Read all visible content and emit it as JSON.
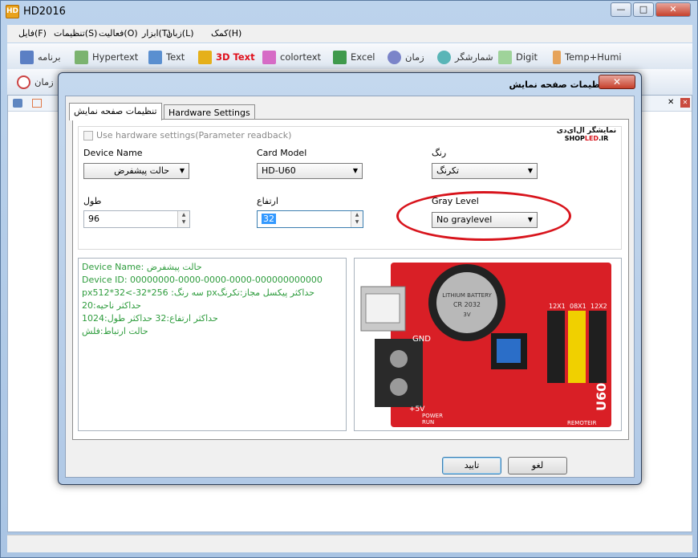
{
  "app": {
    "title": "HD2016",
    "logo": "HD"
  },
  "window_controls": {
    "minimize": "—",
    "maximize": "□",
    "close": "✕"
  },
  "menubar": [
    {
      "label": "(H)کمک"
    },
    {
      "label": "(L)زبان"
    },
    {
      "label": "(T)ابزار"
    },
    {
      "label": "(O)فعالیت"
    },
    {
      "label": "(S)تنظیمات"
    },
    {
      "label": "(F)فایل"
    }
  ],
  "toolbar": [
    {
      "label": "برنامه",
      "icon": "program-icon",
      "color": "#5b7fc4"
    },
    {
      "label": "Hypertext",
      "icon": "hypertext-icon",
      "color": "#7bb36f"
    },
    {
      "label": "Text",
      "icon": "text-icon",
      "color": "#5a8fd0"
    },
    {
      "label": "3D Text",
      "icon": "3d-text-icon",
      "color": "#e5b01a",
      "text_color": "#e0101c"
    },
    {
      "label": "colortext",
      "icon": "colortext-icon",
      "color": "#d66bc6"
    },
    {
      "label": "Excel",
      "icon": "excel-icon",
      "color": "#3f9a4c"
    },
    {
      "label": "زمان",
      "icon": "clock-icon",
      "color": "#7b84c9"
    },
    {
      "label": "شمارشگر",
      "icon": "counter-icon",
      "color": "#59b5b7"
    },
    {
      "label": "Digit",
      "icon": "digit-icon",
      "color": "#9fd39a"
    },
    {
      "label": "Temp+Humi",
      "icon": "thermometer-icon",
      "color": "#e6a35a"
    }
  ],
  "toolbar2": {
    "label": "زمان",
    "icon": "stopwatch-icon"
  },
  "dialog": {
    "title": "تنظیمات صفحه نمایش",
    "close": "✕",
    "tabs": [
      {
        "label": "تنظیمات صفحه نمایش"
      },
      {
        "label": "Hardware Settings"
      }
    ],
    "use_hw_checkbox": "Use hardware settings(Parameter readback)",
    "brand": {
      "line1": "نمایشگر ال‌ای‌دی",
      "line2_a": "SHOP",
      "line2_b": "LED",
      "line2_c": ".IR"
    },
    "fields": {
      "device_name": {
        "label": "Device Name",
        "value": "حالت پیشفرض"
      },
      "card_model": {
        "label": "Card Model",
        "value": "HD-U60"
      },
      "color": {
        "label": "رنگ",
        "value": "تکرنگ"
      },
      "width": {
        "label": "طول",
        "value": "96"
      },
      "height": {
        "label": "ارتفاع",
        "value": "32"
      },
      "gray_level": {
        "label": "Gray Level",
        "value": "No graylevel"
      }
    },
    "info_lines": [
      "Device Name: حالت پیشفرض",
      "Device ID:  00000000-0000-0000-0000-000000000000",
      "px512*32<-سه رنگ: 256*32 pxحداکثر پیکسل مجاز:تکرنگ",
      "حداکثر ناحیه:20",
      "حداکثر ارتفاع:32 حداکثر طول:1024",
      "حالت ارتباط:فلش"
    ],
    "board": {
      "battery_text": "LITHIUM BATTERY",
      "battery_code": "CR 2032",
      "battery_volt": "3V",
      "label_gnd": "GND",
      "label_5v": "+5V",
      "label_model": "U60",
      "label_hub1": "12X1",
      "label_hub2": "08X1",
      "label_hub3": "12X2",
      "label_remote": "REMOTEIR",
      "label_power": "POWER",
      "label_run": "RUN"
    },
    "buttons": {
      "ok": "تایید",
      "cancel": "لغو"
    }
  },
  "colors": {
    "accent_ring": "#d8141c",
    "info_text": "#2e9c3d",
    "board_red": "#d91f26"
  }
}
